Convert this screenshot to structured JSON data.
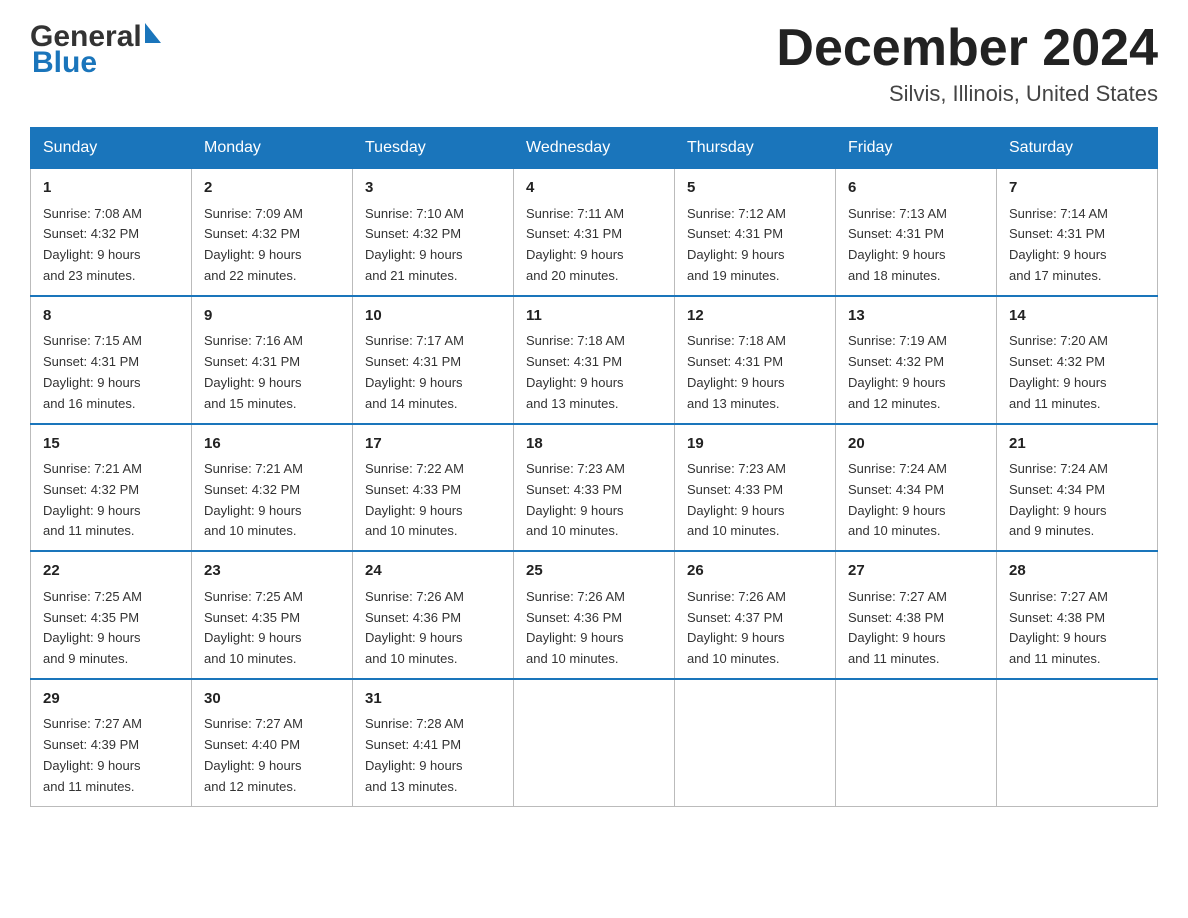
{
  "header": {
    "logo_general": "General",
    "logo_blue": "Blue",
    "month_title": "December 2024",
    "location": "Silvis, Illinois, United States"
  },
  "days_of_week": [
    "Sunday",
    "Monday",
    "Tuesday",
    "Wednesday",
    "Thursday",
    "Friday",
    "Saturday"
  ],
  "weeks": [
    [
      {
        "day": "1",
        "sunrise": "7:08 AM",
        "sunset": "4:32 PM",
        "daylight": "9 hours and 23 minutes."
      },
      {
        "day": "2",
        "sunrise": "7:09 AM",
        "sunset": "4:32 PM",
        "daylight": "9 hours and 22 minutes."
      },
      {
        "day": "3",
        "sunrise": "7:10 AM",
        "sunset": "4:32 PM",
        "daylight": "9 hours and 21 minutes."
      },
      {
        "day": "4",
        "sunrise": "7:11 AM",
        "sunset": "4:31 PM",
        "daylight": "9 hours and 20 minutes."
      },
      {
        "day": "5",
        "sunrise": "7:12 AM",
        "sunset": "4:31 PM",
        "daylight": "9 hours and 19 minutes."
      },
      {
        "day": "6",
        "sunrise": "7:13 AM",
        "sunset": "4:31 PM",
        "daylight": "9 hours and 18 minutes."
      },
      {
        "day": "7",
        "sunrise": "7:14 AM",
        "sunset": "4:31 PM",
        "daylight": "9 hours and 17 minutes."
      }
    ],
    [
      {
        "day": "8",
        "sunrise": "7:15 AM",
        "sunset": "4:31 PM",
        "daylight": "9 hours and 16 minutes."
      },
      {
        "day": "9",
        "sunrise": "7:16 AM",
        "sunset": "4:31 PM",
        "daylight": "9 hours and 15 minutes."
      },
      {
        "day": "10",
        "sunrise": "7:17 AM",
        "sunset": "4:31 PM",
        "daylight": "9 hours and 14 minutes."
      },
      {
        "day": "11",
        "sunrise": "7:18 AM",
        "sunset": "4:31 PM",
        "daylight": "9 hours and 13 minutes."
      },
      {
        "day": "12",
        "sunrise": "7:18 AM",
        "sunset": "4:31 PM",
        "daylight": "9 hours and 13 minutes."
      },
      {
        "day": "13",
        "sunrise": "7:19 AM",
        "sunset": "4:32 PM",
        "daylight": "9 hours and 12 minutes."
      },
      {
        "day": "14",
        "sunrise": "7:20 AM",
        "sunset": "4:32 PM",
        "daylight": "9 hours and 11 minutes."
      }
    ],
    [
      {
        "day": "15",
        "sunrise": "7:21 AM",
        "sunset": "4:32 PM",
        "daylight": "9 hours and 11 minutes."
      },
      {
        "day": "16",
        "sunrise": "7:21 AM",
        "sunset": "4:32 PM",
        "daylight": "9 hours and 10 minutes."
      },
      {
        "day": "17",
        "sunrise": "7:22 AM",
        "sunset": "4:33 PM",
        "daylight": "9 hours and 10 minutes."
      },
      {
        "day": "18",
        "sunrise": "7:23 AM",
        "sunset": "4:33 PM",
        "daylight": "9 hours and 10 minutes."
      },
      {
        "day": "19",
        "sunrise": "7:23 AM",
        "sunset": "4:33 PM",
        "daylight": "9 hours and 10 minutes."
      },
      {
        "day": "20",
        "sunrise": "7:24 AM",
        "sunset": "4:34 PM",
        "daylight": "9 hours and 10 minutes."
      },
      {
        "day": "21",
        "sunrise": "7:24 AM",
        "sunset": "4:34 PM",
        "daylight": "9 hours and 9 minutes."
      }
    ],
    [
      {
        "day": "22",
        "sunrise": "7:25 AM",
        "sunset": "4:35 PM",
        "daylight": "9 hours and 9 minutes."
      },
      {
        "day": "23",
        "sunrise": "7:25 AM",
        "sunset": "4:35 PM",
        "daylight": "9 hours and 10 minutes."
      },
      {
        "day": "24",
        "sunrise": "7:26 AM",
        "sunset": "4:36 PM",
        "daylight": "9 hours and 10 minutes."
      },
      {
        "day": "25",
        "sunrise": "7:26 AM",
        "sunset": "4:36 PM",
        "daylight": "9 hours and 10 minutes."
      },
      {
        "day": "26",
        "sunrise": "7:26 AM",
        "sunset": "4:37 PM",
        "daylight": "9 hours and 10 minutes."
      },
      {
        "day": "27",
        "sunrise": "7:27 AM",
        "sunset": "4:38 PM",
        "daylight": "9 hours and 11 minutes."
      },
      {
        "day": "28",
        "sunrise": "7:27 AM",
        "sunset": "4:38 PM",
        "daylight": "9 hours and 11 minutes."
      }
    ],
    [
      {
        "day": "29",
        "sunrise": "7:27 AM",
        "sunset": "4:39 PM",
        "daylight": "9 hours and 11 minutes."
      },
      {
        "day": "30",
        "sunrise": "7:27 AM",
        "sunset": "4:40 PM",
        "daylight": "9 hours and 12 minutes."
      },
      {
        "day": "31",
        "sunrise": "7:28 AM",
        "sunset": "4:41 PM",
        "daylight": "9 hours and 13 minutes."
      },
      null,
      null,
      null,
      null
    ]
  ],
  "labels": {
    "sunrise": "Sunrise:",
    "sunset": "Sunset:",
    "daylight": "Daylight:"
  }
}
